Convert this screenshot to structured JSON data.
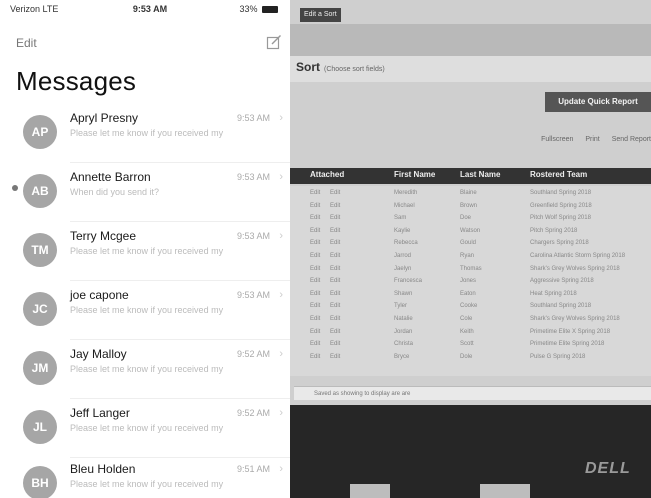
{
  "status_bar": {
    "carrier": "Verizon LTE",
    "time": "9:53 AM",
    "battery": "33%"
  },
  "nav": {
    "edit_label": "Edit",
    "compose_icon": "compose-icon"
  },
  "title": "Messages",
  "conversations": [
    {
      "initials": "AP",
      "name": "Apryl Presny",
      "time": "9:53 AM",
      "preview": "Please let me know if you received my",
      "unread": false
    },
    {
      "initials": "AB",
      "name": "Annette Barron",
      "time": "9:53 AM",
      "preview": "When did you send it?",
      "unread": true
    },
    {
      "initials": "TM",
      "name": "Terry Mcgee",
      "time": "9:53 AM",
      "preview": "Please let me know if you received my",
      "unread": false
    },
    {
      "initials": "JC",
      "name": "joe capone",
      "time": "9:53 AM",
      "preview": "Please let me know if you received my",
      "unread": false
    },
    {
      "initials": "JM",
      "name": "Jay Malloy",
      "time": "9:52 AM",
      "preview": "Please let me know if you received my",
      "unread": false
    },
    {
      "initials": "JL",
      "name": "Jeff Langer",
      "time": "9:52 AM",
      "preview": "Please let me know if you received my",
      "unread": false
    },
    {
      "initials": "BH",
      "name": "Bleu Holden",
      "time": "9:51 AM",
      "preview": "Please let me know if you received my",
      "unread": false
    }
  ],
  "photo": {
    "tag": "Edit a Sort",
    "sort_title": "Sort",
    "sort_subtitle": "(Choose sort fields)",
    "update_button": "Update Quick Report",
    "toolbar": [
      "Fullscreen",
      "Print",
      "Send Report"
    ],
    "table": {
      "headers": [
        "Attached",
        "First Name",
        "Last Name",
        "Rostered Team"
      ],
      "rows": [
        [
          "Edit",
          "Edit",
          "Meredith",
          "Blaine",
          "Southland Spring 2018"
        ],
        [
          "Edit",
          "Edit",
          "Michael",
          "Brown",
          "Greenfield Spring 2018"
        ],
        [
          "Edit",
          "Edit",
          "Sam",
          "Doe",
          "Pitch Wolf Spring 2018"
        ],
        [
          "Edit",
          "Edit",
          "Kaylie",
          "Watson",
          "Pitch Spring 2018"
        ],
        [
          "Edit",
          "Edit",
          "Rebecca",
          "Gould",
          "Chargers Spring 2018"
        ],
        [
          "Edit",
          "Edit",
          "Jarrod",
          "Ryan",
          "Carolina Atlantic Storm Spring 2018"
        ],
        [
          "Edit",
          "Edit",
          "Jaelyn",
          "Thomas",
          "Shark's Grey Wolves Spring 2018"
        ],
        [
          "Edit",
          "Edit",
          "Francesca",
          "Jones",
          "Aggressive Spring 2018"
        ],
        [
          "Edit",
          "Edit",
          "Shawn",
          "Eaton",
          "Heat Spring 2018"
        ],
        [
          "Edit",
          "Edit",
          "Tyler",
          "Cooke",
          "Southland Spring 2018"
        ],
        [
          "Edit",
          "Edit",
          "Natalie",
          "Cole",
          "Shark's Grey Wolves Spring 2018"
        ],
        [
          "Edit",
          "Edit",
          "Jordan",
          "Keith",
          "Primetime Elite X Spring 2018"
        ],
        [
          "Edit",
          "Edit",
          "Christa",
          "Scott",
          "Primetime Elite Spring 2018"
        ],
        [
          "Edit",
          "Edit",
          "Bryce",
          "Dole",
          "Pulse G Spring 2018"
        ]
      ]
    },
    "footer": "Saved as showing to display are are",
    "monitor_brand": "DELL"
  }
}
